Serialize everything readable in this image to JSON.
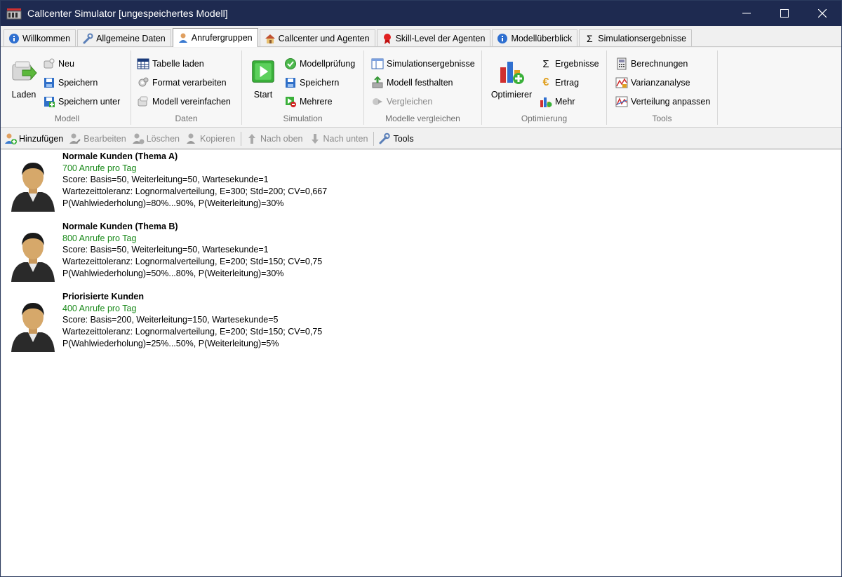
{
  "window": {
    "title": "Callcenter Simulator [ungespeichertes Modell]",
    "controls": {
      "minimize": "—",
      "maximize": "☐",
      "close": "✕"
    }
  },
  "tabs": [
    {
      "label": "Willkommen",
      "icon": "info-icon"
    },
    {
      "label": "Allgemeine Daten",
      "icon": "wrench-icon"
    },
    {
      "label": "Anrufergruppen",
      "icon": "person-icon",
      "active": true
    },
    {
      "label": "Callcenter und Agenten",
      "icon": "house-icon"
    },
    {
      "label": "Skill-Level der Agenten",
      "icon": "ribbon-icon"
    },
    {
      "label": "Modellüberblick",
      "icon": "info-icon"
    },
    {
      "label": "Simulationsergebnisse",
      "icon": "sigma-icon"
    }
  ],
  "ribbon": {
    "modell": {
      "label": "Modell",
      "laden": "Laden",
      "neu": "Neu",
      "speichern": "Speichern",
      "speichern_unter": "Speichern unter"
    },
    "daten": {
      "label": "Daten",
      "tabelle_laden": "Tabelle laden",
      "format_verarbeiten": "Format verarbeiten",
      "modell_vereinfachen": "Modell vereinfachen"
    },
    "simulation": {
      "label": "Simulation",
      "start": "Start",
      "modellpruefung": "Modellprüfung",
      "speichern": "Speichern",
      "mehrere": "Mehrere"
    },
    "vergleichen": {
      "label": "Modelle vergleichen",
      "simulationsergebnisse": "Simulationsergebnisse",
      "modell_festhalten": "Modell festhalten",
      "vergleichen": "Vergleichen"
    },
    "optimierung": {
      "label": "Optimierung",
      "optimierer": "Optimierer",
      "ergebnisse": "Ergebnisse",
      "ertrag": "Ertrag",
      "mehr": "Mehr"
    },
    "tools": {
      "label": "Tools",
      "berechnungen": "Berechnungen",
      "varianzanalyse": "Varianzanalyse",
      "verteilung_anpassen": "Verteilung anpassen"
    }
  },
  "toolbar": {
    "hinzufuegen": "Hinzufügen",
    "bearbeiten": "Bearbeiten",
    "loeschen": "Löschen",
    "kopieren": "Kopieren",
    "nach_oben": "Nach oben",
    "nach_unten": "Nach unten",
    "tools": "Tools"
  },
  "callers": [
    {
      "name": "Normale Kunden (Thema A)",
      "calls": "700 Anrufe pro Tag",
      "score": "Score: Basis=50, Weiterleitung=50, Wartesekunde=1",
      "wait": "Wartezeittoleranz: Lognormalverteilung, E=300; Std=200; CV=0,667",
      "prob": "P(Wahlwiederholung)=80%...90%, P(Weiterleitung)=30%"
    },
    {
      "name": "Normale Kunden (Thema B)",
      "calls": "800 Anrufe pro Tag",
      "score": "Score: Basis=50, Weiterleitung=50, Wartesekunde=1",
      "wait": "Wartezeittoleranz: Lognormalverteilung, E=200; Std=150; CV=0,75",
      "prob": "P(Wahlwiederholung)=50%...80%, P(Weiterleitung)=30%"
    },
    {
      "name": "Priorisierte Kunden",
      "calls": "400 Anrufe pro Tag",
      "score": "Score: Basis=200, Weiterleitung=150, Wartesekunde=5",
      "wait": "Wartezeittoleranz: Lognormalverteilung, E=200; Std=150; CV=0,75",
      "prob": "P(Wahlwiederholung)=25%...50%, P(Weiterleitung)=5%"
    }
  ],
  "colors": {
    "titlebar": "#1e2a50",
    "calls_text": "#1a8a1a",
    "disabled_text": "#8a8a8a"
  }
}
